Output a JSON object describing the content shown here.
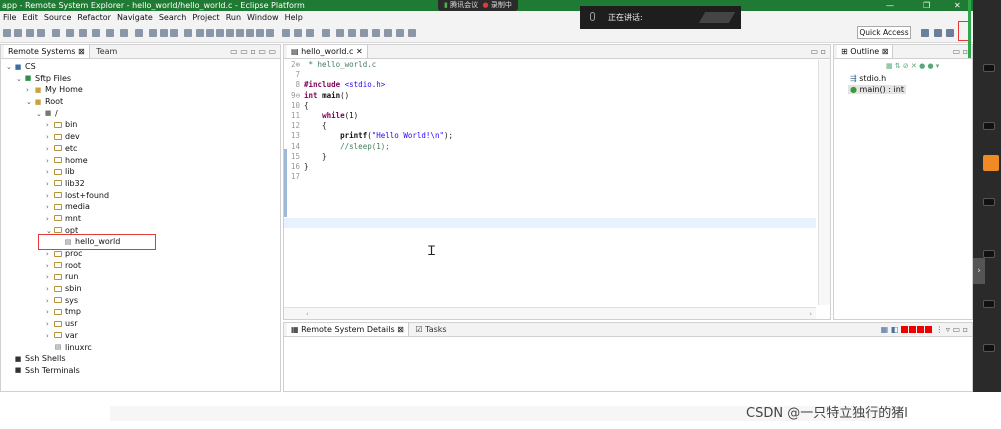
{
  "window": {
    "title": "app - Remote System Explorer - hello_world/hello_world.c - Eclipse Platform",
    "controls": [
      "—",
      "❐",
      "✕"
    ]
  },
  "overlays": {
    "meeting_app": "腾讯会议",
    "recording": "录制中",
    "speaking": "正在讲话:"
  },
  "menu": [
    "File",
    "Edit",
    "Source",
    "Refactor",
    "Navigate",
    "Search",
    "Project",
    "Run",
    "Window",
    "Help"
  ],
  "toolbar": {
    "quick_access": "Quick Access"
  },
  "left_panel": {
    "tabs": [
      "Remote Systems ⊠",
      "Team"
    ],
    "tree": [
      {
        "depth": 0,
        "twisty": "⌄",
        "icon": "connection-icon",
        "label": "CS"
      },
      {
        "depth": 1,
        "twisty": "⌄",
        "icon": "sftp-icon",
        "label": "Sftp Files"
      },
      {
        "depth": 2,
        "twisty": "›",
        "icon": "home-folder-icon",
        "label": "My Home"
      },
      {
        "depth": 2,
        "twisty": "⌄",
        "icon": "root-folder-icon",
        "label": "Root"
      },
      {
        "depth": 3,
        "twisty": "⌄",
        "icon": "drive-icon",
        "label": "/"
      },
      {
        "depth": 4,
        "twisty": "›",
        "icon": "folder-icon",
        "label": "bin"
      },
      {
        "depth": 4,
        "twisty": "›",
        "icon": "folder-icon",
        "label": "dev"
      },
      {
        "depth": 4,
        "twisty": "›",
        "icon": "folder-icon",
        "label": "etc"
      },
      {
        "depth": 4,
        "twisty": "›",
        "icon": "folder-icon",
        "label": "home"
      },
      {
        "depth": 4,
        "twisty": "›",
        "icon": "folder-icon",
        "label": "lib"
      },
      {
        "depth": 4,
        "twisty": "›",
        "icon": "folder-icon",
        "label": "lib32"
      },
      {
        "depth": 4,
        "twisty": "›",
        "icon": "folder-icon",
        "label": "lost+found"
      },
      {
        "depth": 4,
        "twisty": "›",
        "icon": "folder-icon",
        "label": "media"
      },
      {
        "depth": 4,
        "twisty": "›",
        "icon": "folder-icon",
        "label": "mnt"
      },
      {
        "depth": 4,
        "twisty": "⌄",
        "icon": "folder-open-icon",
        "label": "opt"
      },
      {
        "depth": 5,
        "twisty": "",
        "icon": "file-icon",
        "label": "hello_world"
      },
      {
        "depth": 4,
        "twisty": "›",
        "icon": "folder-icon",
        "label": "proc"
      },
      {
        "depth": 4,
        "twisty": "›",
        "icon": "folder-icon",
        "label": "root"
      },
      {
        "depth": 4,
        "twisty": "›",
        "icon": "folder-icon",
        "label": "run"
      },
      {
        "depth": 4,
        "twisty": "›",
        "icon": "folder-icon",
        "label": "sbin"
      },
      {
        "depth": 4,
        "twisty": "›",
        "icon": "folder-icon",
        "label": "sys"
      },
      {
        "depth": 4,
        "twisty": "›",
        "icon": "folder-icon",
        "label": "tmp"
      },
      {
        "depth": 4,
        "twisty": "›",
        "icon": "folder-icon",
        "label": "usr"
      },
      {
        "depth": 4,
        "twisty": "›",
        "icon": "folder-icon",
        "label": "var"
      },
      {
        "depth": 4,
        "twisty": "",
        "icon": "file-icon",
        "label": "linuxrc"
      },
      {
        "depth": 0,
        "twisty": "",
        "icon": "shell-icon",
        "label": "Ssh Shells"
      },
      {
        "depth": 0,
        "twisty": "",
        "icon": "terminal-icon",
        "label": "Ssh Terminals"
      }
    ]
  },
  "editor": {
    "tab": "hello_world.c",
    "lines": [
      {
        "n": "2⊕",
        "html": "<span class='cm'> * hello_world.c</span>"
      },
      {
        "n": "7",
        "html": ""
      },
      {
        "n": "8",
        "html": "<span class='inc'>#include</span> <span class='str'>&lt;stdio.h&gt;</span>"
      },
      {
        "n": "9⊖",
        "html": "<span class='kw'>int</span> <b>main</b>()"
      },
      {
        "n": "10",
        "html": "{"
      },
      {
        "n": "11",
        "html": "    <span class='kw'>while</span>(1)"
      },
      {
        "n": "12",
        "html": "    {"
      },
      {
        "n": "13",
        "html": "        <b>printf</b>(<span class='str'>\"Hello World!\\n\"</span>);"
      },
      {
        "n": "14",
        "html": "        <span class='cm'>//sleep(1);</span>"
      },
      {
        "n": "15",
        "html": "    }"
      },
      {
        "n": "16",
        "html": "}"
      },
      {
        "n": "17",
        "html": ""
      }
    ]
  },
  "outline": {
    "tab": "Outline",
    "items": [
      {
        "icon": "include-icon",
        "label": "stdio.h"
      },
      {
        "icon": "function-icon",
        "label": "main() : int"
      }
    ]
  },
  "bottom_panel": {
    "tabs": [
      "Remote System Details ⊠",
      "Tasks"
    ]
  },
  "watermark": "CSDN @一只特立独行的猪l"
}
